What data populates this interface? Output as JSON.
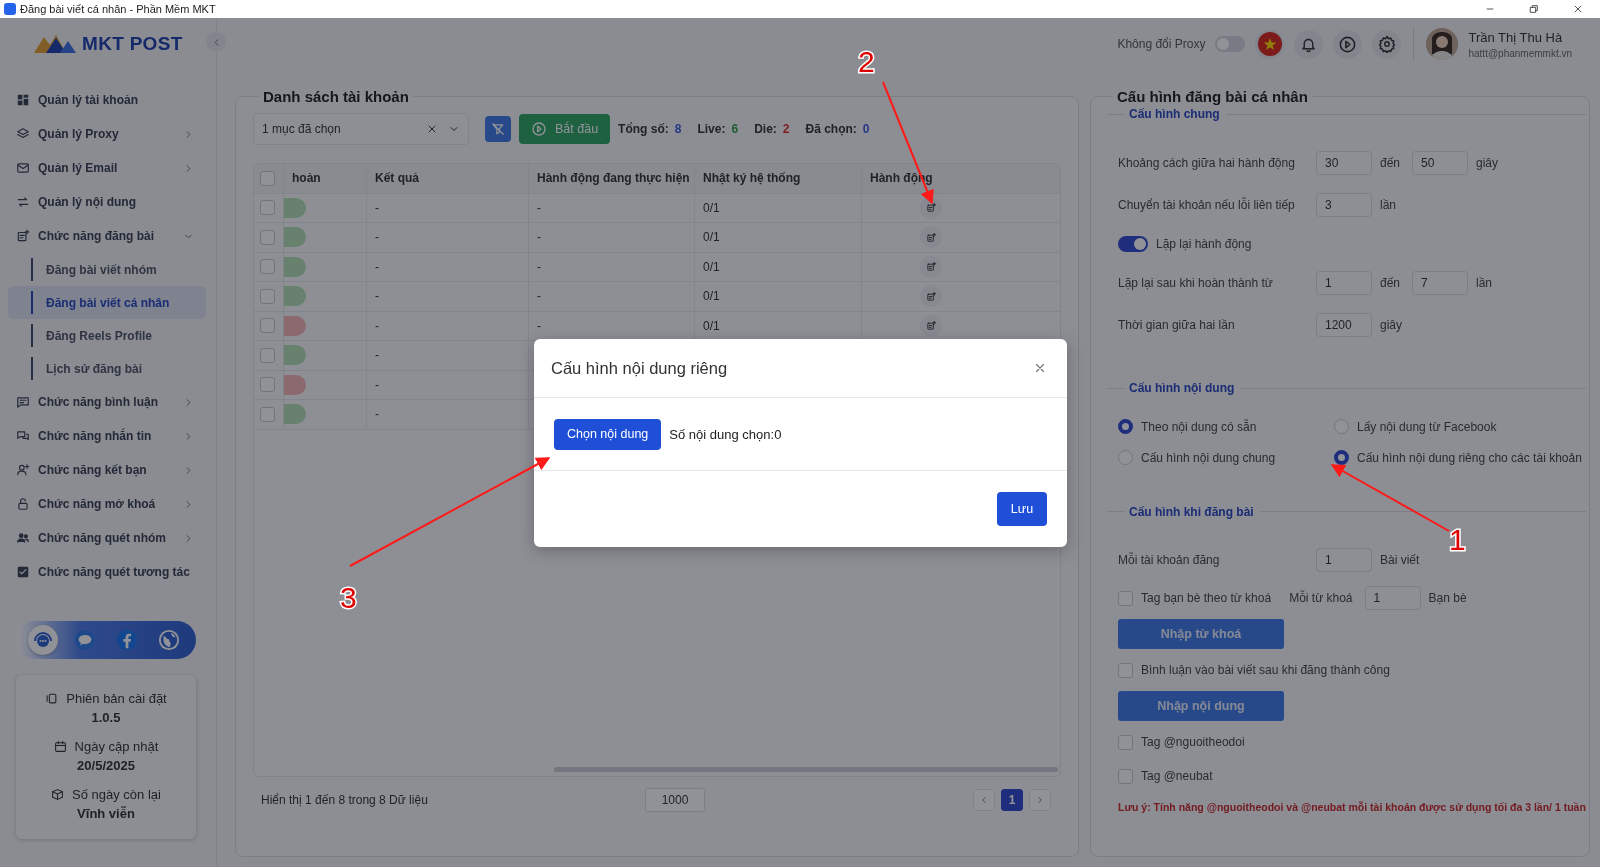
{
  "window": {
    "title": "Đăng bài viết cá nhân - Phần Mềm MKT"
  },
  "sidebar": {
    "logo": "MKT POST",
    "menu": [
      {
        "label": "Quản lý tài khoản"
      },
      {
        "label": "Quản lý Proxy",
        "expanded": false
      },
      {
        "label": "Quản lý Email",
        "expanded": false
      },
      {
        "label": "Quản lý nội dung"
      },
      {
        "label": "Chức năng đăng bài",
        "expanded": true,
        "children": [
          {
            "label": "Đăng bài viết nhóm",
            "selected": false
          },
          {
            "label": "Đăng bài viết cá nhân",
            "selected": true
          },
          {
            "label": "Đăng Reels Profile",
            "selected": false
          },
          {
            "label": "Lịch sử đăng bài",
            "selected": false
          }
        ]
      },
      {
        "label": "Chức năng bình luận",
        "expanded": false
      },
      {
        "label": "Chức năng nhắn tin",
        "expanded": false
      },
      {
        "label": "Chức năng kết bạn",
        "expanded": false
      },
      {
        "label": "Chức năng mở khoá",
        "expanded": false
      },
      {
        "label": "Chức năng quét nhóm",
        "expanded": false
      },
      {
        "label": "Chức năng quét tương tác"
      }
    ],
    "info": [
      {
        "label": "Phiên bản cài đặt",
        "value": "1.0.5"
      },
      {
        "label": "Ngày cập nhật",
        "value": "20/5/2025"
      },
      {
        "label": "Số ngày còn lại",
        "value": "Vĩnh viễn"
      }
    ]
  },
  "header": {
    "proxy": {
      "label": "Không đổi Proxy",
      "on": false
    },
    "user": {
      "name": "Trần Thị Thu Hà",
      "email": "hattt@phanmemmkt.vn"
    }
  },
  "accounts": {
    "title": "Danh sách tài khoản",
    "select": {
      "value": "1 mục đã chọn"
    },
    "start_button": "Bắt đầu",
    "stats": [
      {
        "label": "Tổng số:",
        "value": "8",
        "kind": "total"
      },
      {
        "label": "Live:",
        "value": "6",
        "kind": "live"
      },
      {
        "label": "Die:",
        "value": "2",
        "kind": "die"
      },
      {
        "label": "Đã chọn:",
        "value": "0",
        "kind": "selected"
      }
    ],
    "table": {
      "all_checked": false,
      "columns": [
        "hoản",
        "Kết quả",
        "Hành động đang thực hiện",
        "Nhật ký hệ thống",
        "Hành động"
      ],
      "rows": [
        {
          "checked": false,
          "live": true,
          "result": "-",
          "action": "-",
          "log": "0/1"
        },
        {
          "checked": false,
          "live": true,
          "result": "-",
          "action": "-",
          "log": "0/1"
        },
        {
          "checked": false,
          "live": true,
          "result": "-",
          "action": "-",
          "log": "0/1"
        },
        {
          "checked": false,
          "live": true,
          "result": "-",
          "action": "-",
          "log": "0/1"
        },
        {
          "checked": false,
          "live": false,
          "result": "-",
          "action": "-",
          "log": "0/1"
        },
        {
          "checked": false,
          "live": true,
          "result": "-"
        },
        {
          "checked": false,
          "live": false,
          "result": "-"
        },
        {
          "checked": false,
          "live": true,
          "result": "-"
        }
      ]
    },
    "footer": {
      "summary": "Hiển thị 1 đến 8 trong 8 Dữ liệu",
      "page_size": "1000",
      "pages": [
        {
          "label": "1",
          "selected": true
        }
      ]
    }
  },
  "config": {
    "title": "Cấu hình đăng bài cá nhân",
    "sections": [
      {
        "title": "Cấu hình chung",
        "items": [
          {
            "kind": "inputs",
            "label": "Khoảng cách giữa hai hành động",
            "parts": [
              {
                "kind": "field",
                "value": "30"
              },
              {
                "kind": "unit",
                "text": "đến"
              },
              {
                "kind": "field",
                "value": "50"
              },
              {
                "kind": "unit",
                "text": "giây"
              }
            ]
          },
          {
            "kind": "inputs",
            "label": "Chuyển tài khoản nếu lỗi liên tiếp",
            "parts": [
              {
                "kind": "field",
                "value": "3"
              },
              {
                "kind": "unit",
                "text": "lần"
              }
            ]
          },
          {
            "kind": "toggle",
            "label": "Lặp lại hành động",
            "on": true
          },
          {
            "kind": "inputs",
            "label": "Lặp lại sau khi hoàn thành từ",
            "parts": [
              {
                "kind": "field",
                "value": "1"
              },
              {
                "kind": "unit",
                "text": "đến"
              },
              {
                "kind": "field",
                "value": "7"
              },
              {
                "kind": "unit",
                "text": "lần"
              }
            ]
          },
          {
            "kind": "inputs",
            "label": "Thời gian giữa hai lần",
            "parts": [
              {
                "kind": "field",
                "value": "1200"
              },
              {
                "kind": "unit",
                "text": "giây"
              }
            ]
          }
        ]
      },
      {
        "title": "Cấu hình nội dung",
        "items": [
          {
            "kind": "radios",
            "options": [
              {
                "label": "Theo nội dung có sẵn",
                "selected": true
              },
              {
                "label": "Lấy nội dung từ Facebook",
                "selected": false
              },
              {
                "label": "Cấu hình nội dung chung",
                "selected": false
              },
              {
                "label": "Cấu hình nội dung riêng cho các tài khoản",
                "selected": true
              }
            ]
          }
        ]
      },
      {
        "title": "Cấu hình khi đăng bài",
        "items": [
          {
            "kind": "inputs",
            "label": "Mỗi tài khoản đăng",
            "parts": [
              {
                "kind": "field",
                "value": "1"
              },
              {
                "kind": "unit",
                "text": "Bài viết"
              }
            ]
          },
          {
            "kind": "checkbox",
            "label": "Tag bạn bè theo từ khoá",
            "checked": false,
            "parts": [
              {
                "kind": "unit",
                "text": "Mỗi từ khoá"
              },
              {
                "kind": "field",
                "value": "1"
              },
              {
                "kind": "unit",
                "text": "Bạn bè"
              }
            ]
          },
          {
            "kind": "button",
            "label": "Nhập từ khoá"
          },
          {
            "kind": "checkbox",
            "label": "Bình luận vào bài viết sau khi đăng thành công",
            "checked": false
          },
          {
            "kind": "button",
            "label": "Nhập nội dung"
          },
          {
            "kind": "checkbox",
            "label": "Tag @nguoitheodoi",
            "checked": false
          },
          {
            "kind": "checkbox",
            "label": "Tag @neubat",
            "checked": false
          },
          {
            "kind": "note",
            "text": "Lưu ý: Tính năng @nguoitheodoi và @neubat mỗi tài khoản được sử dụng tối đa 3 lần/ 1 tuần"
          }
        ]
      }
    ]
  },
  "modal": {
    "title": "Cấu hình nội dung riêng",
    "choose_button": "Chọn nội dung",
    "count": "Số nội dung chọn:0",
    "save_button": "Lưu"
  },
  "annotations": [
    {
      "label": "1"
    },
    {
      "label": "2"
    },
    {
      "label": "3"
    }
  ]
}
